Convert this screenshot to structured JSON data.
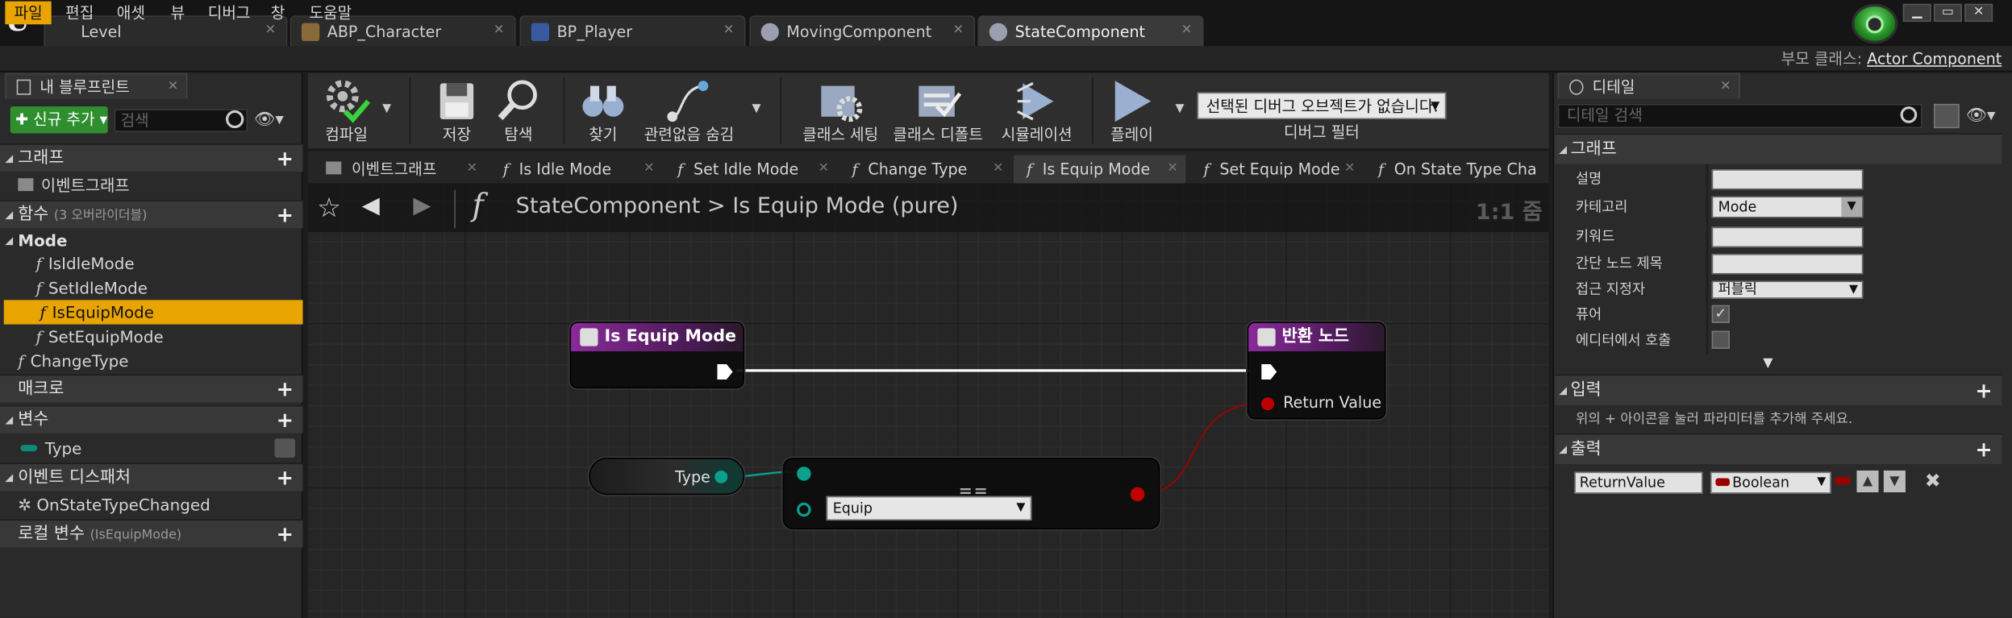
{
  "tabs": [
    {
      "label": "Level",
      "icon": "level-icon"
    },
    {
      "label": "ABP_Character",
      "icon": "anim-blueprint-icon"
    },
    {
      "label": "BP_Player",
      "icon": "blueprint-icon"
    },
    {
      "label": "MovingComponent",
      "icon": "component-icon"
    },
    {
      "label": "StateComponent",
      "icon": "component-icon"
    }
  ],
  "menu": [
    "파일",
    "편집",
    "애셋",
    "뷰",
    "디버그",
    "창",
    "도움말"
  ],
  "parent_class": {
    "label": "부모 클래스:",
    "value": "Actor Component"
  },
  "my_blueprint": {
    "tab": "내 블루프린트",
    "add_new": "신규 추가",
    "search_placeholder": "검색",
    "sections": {
      "graph": "그래프",
      "functions": "함수",
      "functions_note": "(3 오버라이더블)",
      "macros": "매크로",
      "variables": "변수",
      "dispatchers": "이벤트 디스패처",
      "local_vars": "로컬 변수",
      "local_vars_note": "(IsEquipMode)"
    },
    "event_graph": "이벤트그래프",
    "category_mode": "Mode",
    "functions": [
      "IsIdleMode",
      "SetIdleMode",
      "IsEquipMode",
      "SetEquipMode",
      "ChangeType"
    ],
    "variable": "Type",
    "dispatcher": "OnStateTypeChanged"
  },
  "toolbar": {
    "compile": "컴파일",
    "save": "저장",
    "browse": "탐색",
    "find": "찾기",
    "hide_unrelated": "관련없음 숨김",
    "class_settings": "클래스 세팅",
    "class_defaults": "클래스 디폴트",
    "simulation": "시뮬레이션",
    "play": "플레이",
    "debug_object": "선택된 디버그 오브젝트가 없습니다.",
    "debug_filter": "디버그 필터"
  },
  "graph_tabs": [
    "이벤트그래프",
    "Is Idle Mode",
    "Set Idle Mode",
    "Change Type",
    "Is Equip Mode",
    "Set Equip Mode",
    "On State Type Cha"
  ],
  "graph": {
    "breadcrumb_root": "StateComponent",
    "breadcrumb_sep": ">",
    "breadcrumb_current": "Is Equip Mode (pure)",
    "zoom": "1:1 줌",
    "entry_node": "Is Equip Mode",
    "return_node": "반환 노드",
    "return_pin": "Return Value",
    "var_node": "Type",
    "compare_symbol": "==",
    "enum_value": "Equip"
  },
  "details": {
    "tab": "디테일",
    "search_placeholder": "디테일 검색",
    "graph_section": "그래프",
    "description_label": "설명",
    "category_label": "카테고리",
    "category_value": "Mode",
    "keywords_label": "키워드",
    "compact_title_label": "간단 노드 제목",
    "access_label": "접근 지정자",
    "access_value": "퍼블릭",
    "pure_label": "퓨어",
    "call_in_editor_label": "에디터에서 호출",
    "inputs_section": "입력",
    "inputs_hint": "위의 + 아이콘을 눌러 파라미터를 추가해 주세요.",
    "outputs_section": "출력",
    "output_name": "ReturnValue",
    "output_type": "Boolean"
  },
  "colors": {
    "accent": "#e8a400",
    "bool_pin": "#9a0000",
    "enum_pin": "#00a08a",
    "add_green": "#2f8f2f"
  }
}
